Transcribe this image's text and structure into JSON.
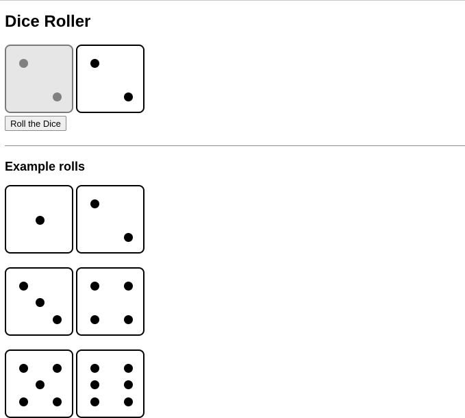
{
  "page": {
    "title": "Dice Roller"
  },
  "roller": {
    "dice": [
      2,
      2
    ],
    "first_die_disabled": true,
    "button_label": "Roll the Dice"
  },
  "examples": {
    "heading": "Example rolls",
    "rows": [
      [
        1,
        2
      ],
      [
        3,
        4
      ],
      [
        5,
        6
      ]
    ]
  }
}
